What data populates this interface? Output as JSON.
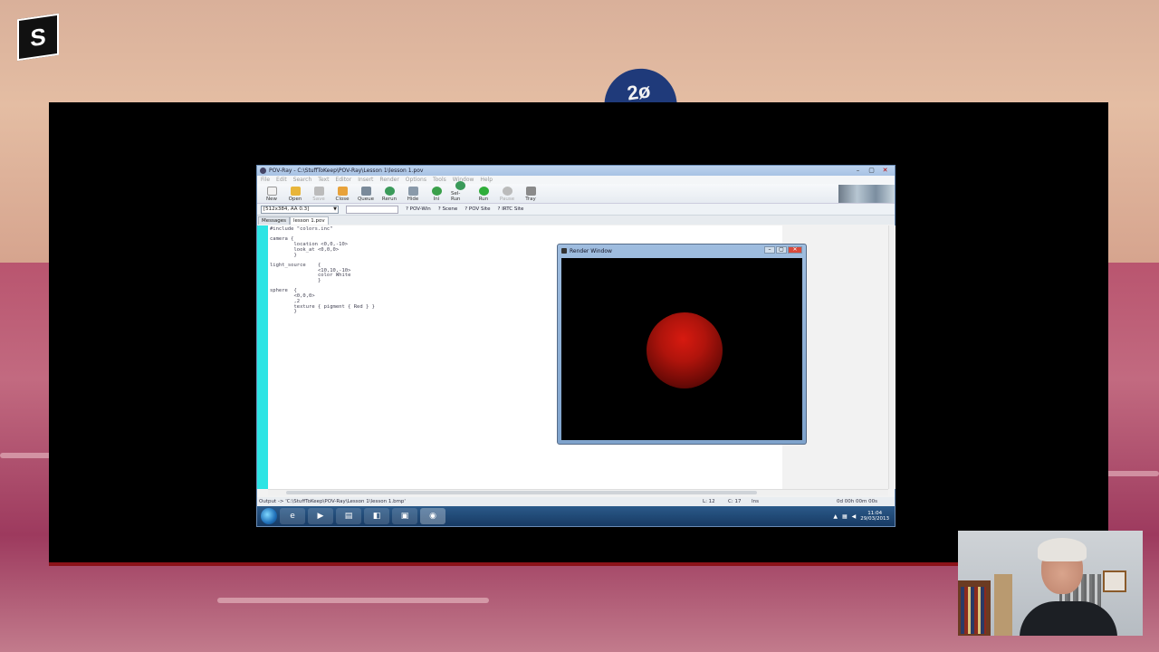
{
  "overlay": {
    "logo_text": "S",
    "dome_text": "2ø"
  },
  "app": {
    "title": "POV-Ray - C:\\StuffToKeep\\POV-Ray\\Lesson 1\\lesson 1.pov",
    "menu": [
      "File",
      "Edit",
      "Search",
      "Text",
      "Editor",
      "Insert",
      "Render",
      "Options",
      "Tools",
      "Window",
      "Help"
    ],
    "toolbar": [
      {
        "label": "New",
        "icon": "new-file-icon",
        "color": "#f2f2f2"
      },
      {
        "label": "Open",
        "icon": "open-folder-icon",
        "color": "#e8b53a"
      },
      {
        "label": "Save",
        "icon": "save-icon",
        "color": "#bbbbbb",
        "disabled": true
      },
      {
        "label": "Close",
        "icon": "close-file-icon",
        "color": "#e8a23a"
      },
      {
        "label": "Queue",
        "icon": "queue-icon",
        "color": "#7a8a9a"
      },
      {
        "label": "Rerun",
        "icon": "rerun-icon",
        "color": "#3a9a5a"
      },
      {
        "label": "Hide",
        "icon": "hide-icon",
        "color": "#8a9aaa"
      },
      {
        "label": "Ini",
        "icon": "ini-icon",
        "color": "#3aa04a"
      },
      {
        "label": "Sel-Run",
        "icon": "sel-run-icon",
        "color": "#3a9a5a"
      },
      {
        "label": "Run",
        "icon": "run-icon",
        "color": "#2fae3a"
      },
      {
        "label": "Pause",
        "icon": "pause-icon",
        "color": "#bbbbbb",
        "disabled": true
      },
      {
        "label": "Tray",
        "icon": "tray-icon",
        "color": "#8a8a8a"
      }
    ],
    "resolution": "[512x384, AA 0.3]",
    "help_links": [
      "POV-Win",
      "Scene",
      "POV Site",
      "IRTC Site"
    ],
    "tabs": [
      "Messages",
      "lesson 1.pov"
    ],
    "active_tab": "lesson 1.pov",
    "code": "#include \"colors.inc\"\n\ncamera {\n        location <0,0,-10>\n        look_at <0,0,0>\n        }\n\nlight_source    {\n                <10,10,-10>\n                color White\n                }\n\nsphere  {\n        <0,0,0>\n        ,2\n        texture { pigment { Red } }\n        }",
    "status": {
      "output": "Output -> 'C:\\StuffToKeep\\POV-Ray\\Lesson 1\\lesson 1.bmp'",
      "line": "L: 12",
      "col": "C: 17",
      "mode": "Ins",
      "time": "0d 00h 00m 00s"
    }
  },
  "render_window": {
    "title": "Render Window"
  },
  "taskbar": {
    "apps": [
      "ie-icon",
      "media-player-icon",
      "explorer-icon",
      "generic-app-icon",
      "folder-icon",
      "povray-icon"
    ],
    "clock_time": "11:04",
    "clock_date": "29/03/2013"
  }
}
